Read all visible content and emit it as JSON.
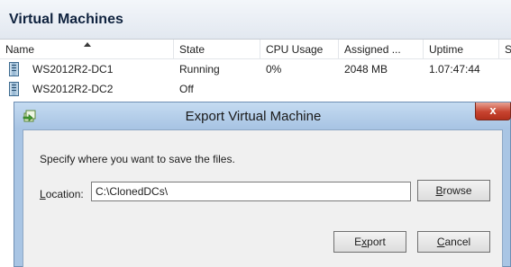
{
  "panel": {
    "title": "Virtual Machines",
    "columns": [
      "Name",
      "State",
      "CPU Usage",
      "Assigned ...",
      "Uptime",
      "S"
    ],
    "rows": [
      {
        "name": "WS2012R2-DC1",
        "state": "Running",
        "cpu": "0%",
        "memory": "2048 MB",
        "uptime": "1.07:47:44"
      },
      {
        "name": "WS2012R2-DC2",
        "state": "Off",
        "cpu": "",
        "memory": "",
        "uptime": ""
      }
    ]
  },
  "dialog": {
    "title": "Export Virtual Machine",
    "close_label": "x",
    "prompt": "Specify where you want to save the files.",
    "location_label_accel": "L",
    "location_label_rest": "ocation:",
    "location_value": "C:\\ClonedDCs\\",
    "browse_accel": "B",
    "browse_rest": "rowse",
    "export_pre": "E",
    "export_accel": "x",
    "export_rest": "port",
    "cancel_accel": "C",
    "cancel_rest": "ancel"
  }
}
